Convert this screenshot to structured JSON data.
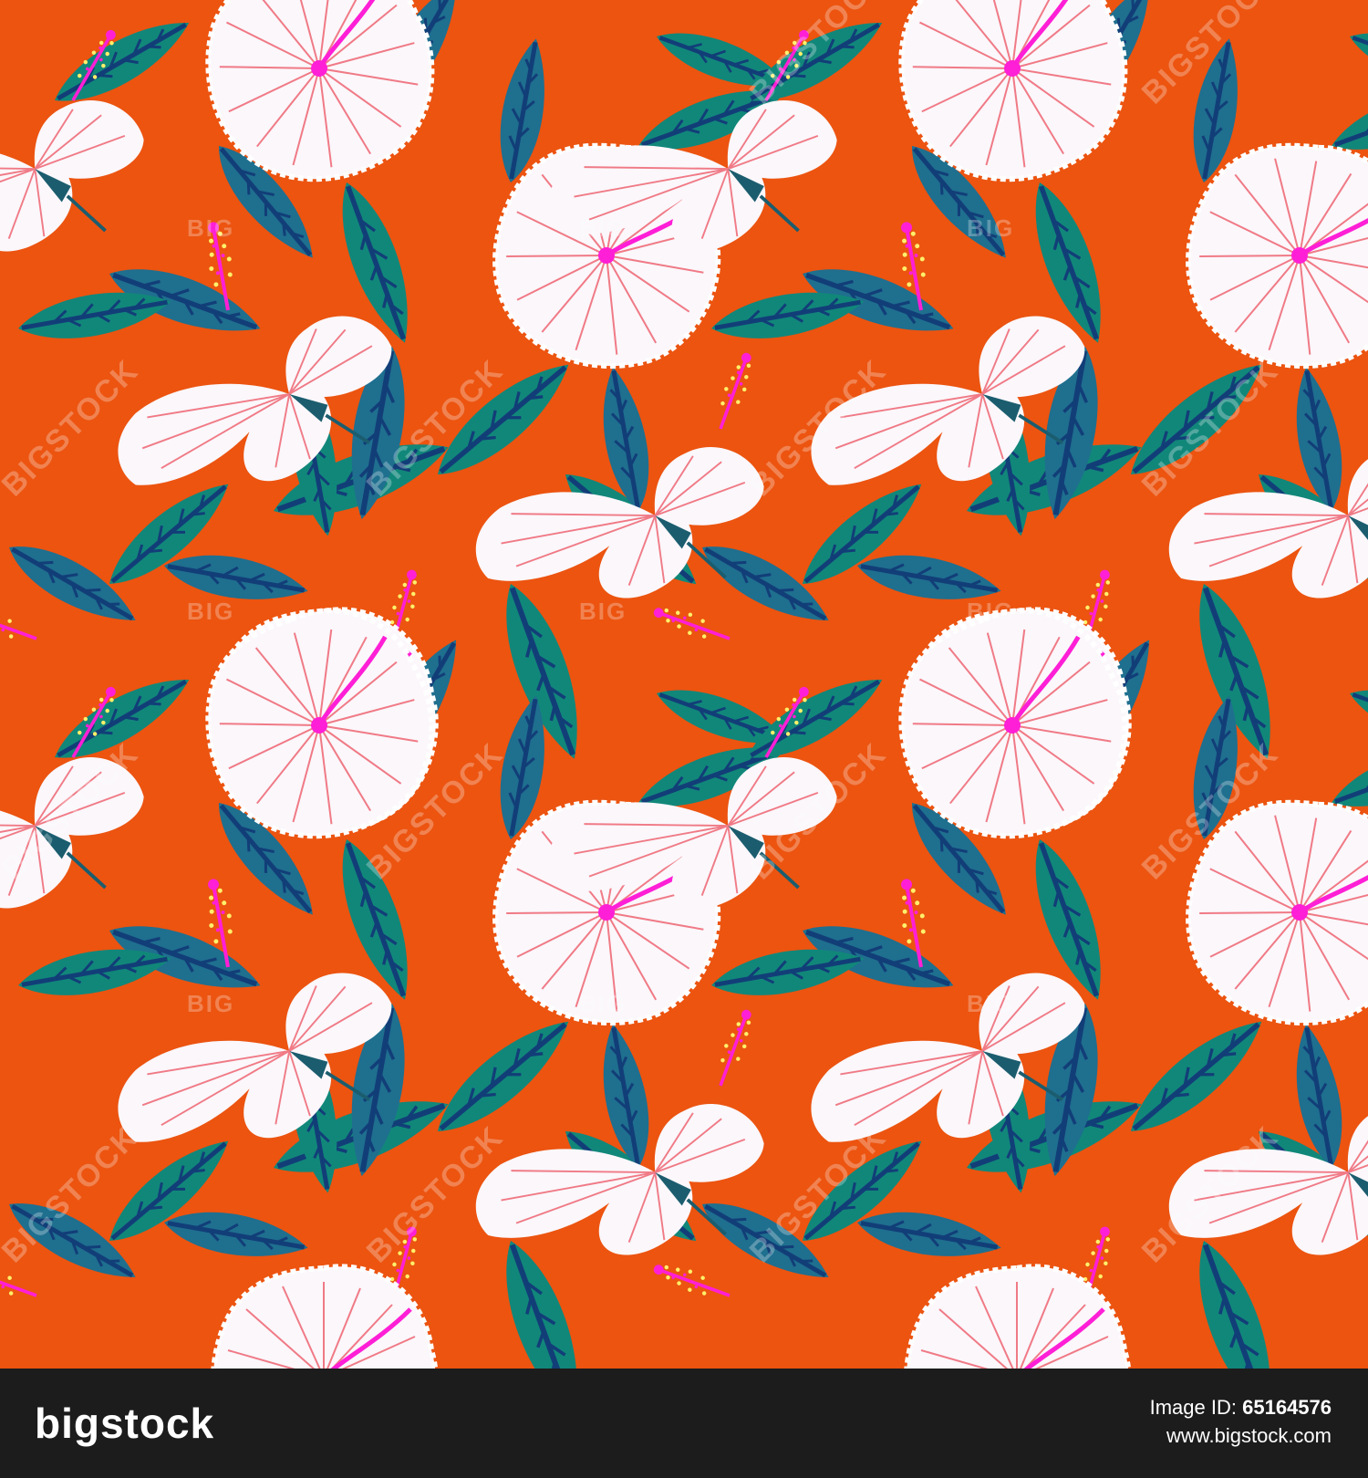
{
  "pattern": {
    "colors": {
      "background": "#ec5410",
      "leaf_teal": "#11877a",
      "leaf_blue": "#1f6f8f",
      "leaf_vein": "#123e78",
      "petal_white": "#fbf7fb",
      "petal_line": "#f07a86",
      "stamen_magenta": "#ff1fd6",
      "pollen_yellow": "#fff06a",
      "calyx": "#1b5d6e"
    },
    "icons": [
      "hibiscus-flower-icon",
      "tropical-leaf-icon",
      "hibiscus-stamen-icon"
    ]
  },
  "watermark": {
    "big_text": "BIG",
    "full_text": "BIGSTOCK"
  },
  "footer": {
    "logo": "bigstock",
    "image_id_label": "Image ID:",
    "image_id_value": "65164576",
    "url": "www.bigstock.com"
  }
}
